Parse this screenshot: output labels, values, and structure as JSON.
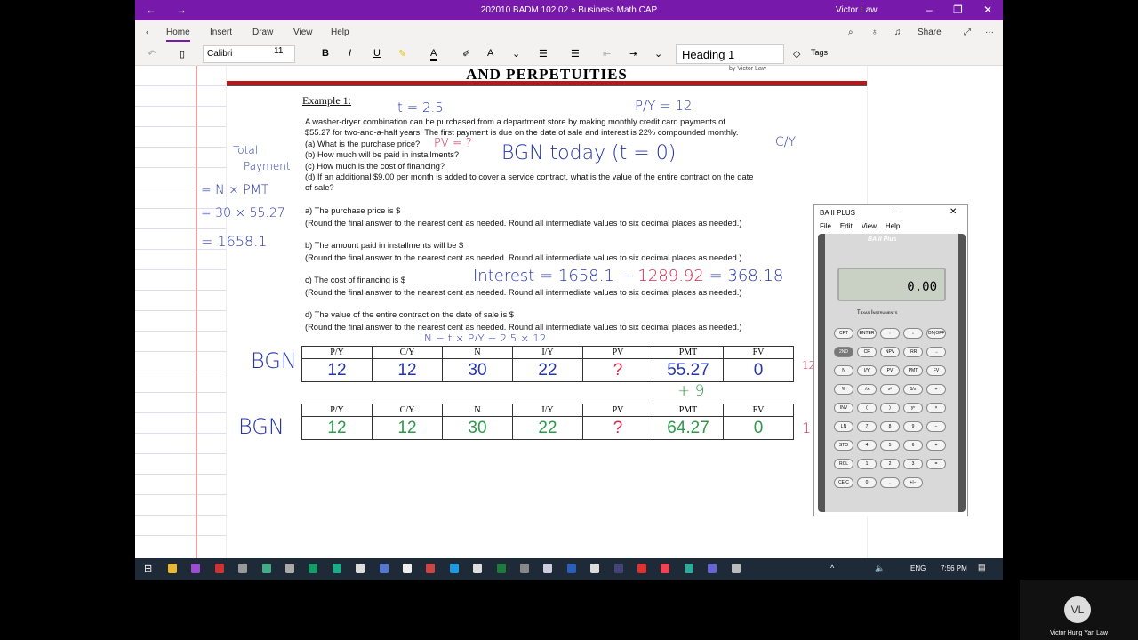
{
  "window": {
    "title": "202010 BADM 102 02 » Business Math CAP",
    "user": "Victor Law",
    "back": "←",
    "forward": "→",
    "min": "–",
    "max": "❐",
    "close": "✕"
  },
  "ribbon": {
    "tabs": [
      "Home",
      "Insert",
      "Draw",
      "View",
      "Help"
    ],
    "share": "Share",
    "more": "···"
  },
  "toolbar": {
    "font": "Calibri",
    "size": "11",
    "bold": "B",
    "italic": "I",
    "underline": "U",
    "font_color": "A",
    "style": "Heading 1",
    "tags": "Tags"
  },
  "doc": {
    "header": "AND PERPETUITIES",
    "byline": "by Victor Law",
    "example": "Example 1:",
    "problem": [
      "A washer-dryer combination can be purchased from a department store by making monthly credit card payments of",
      "$55.27 for two-and-a-half years. The first payment is due on the date of sale and interest is 22% compounded monthly.",
      "(a) What is the purchase price?",
      "(b) How much will be paid in installments?",
      "(c) How much is the cost of financing?",
      "(d) If an additional $9.00 per month is added to cover a service contract, what is the value of the entire contract on the date",
      "of sale?"
    ],
    "answers": [
      "a) The purchase price is $",
      "b) The amount paid in installments will be $",
      "c) The cost of financing is $",
      "d) The value of the entire contract on the date of sale is $"
    ],
    "round_note": "(Round the final answer to the nearest cent as needed. Round all intermediate values to six decimal places as needed.)",
    "table_headers": [
      "P/Y",
      "C/Y",
      "N",
      "I/Y",
      "PV",
      "PMT",
      "FV"
    ],
    "table1": [
      "12",
      "12",
      "30",
      "22",
      "?",
      "55.27",
      "0"
    ],
    "table2": [
      "12",
      "12",
      "30",
      "22",
      "?",
      "64.27",
      "0"
    ]
  },
  "handwriting": {
    "t": "t = 2.5",
    "py": "P/Y = 12",
    "pv": "PV = ?",
    "bgn_today": "BGN today (t = 0)",
    "cy": "C/Y",
    "total": "Total",
    "payment": "Payment",
    "nxpmt": "= N × PMT",
    "calc1": "= 30 × 55.27",
    "calc2": "= 1658.1",
    "interest": "Interest = 1658.1 − ",
    "pv_val": "1289.92",
    "int_result": " = 368.18",
    "nformula": "N = t × P/Y = 2.5 × 12",
    "bgn1": "BGN",
    "bgn2": "BGN",
    "plus9": "+ 9",
    "side1": "12",
    "side2": "1"
  },
  "calculator": {
    "title": "BA II PLUS",
    "menu": [
      "File",
      "Edit",
      "View",
      "Help"
    ],
    "brand": "BA II Plus",
    "maker": "Texas Instruments",
    "display": "0.00",
    "keys": [
      "CPT",
      "ENTER",
      "↑",
      "↓",
      "ON|OFF",
      "2ND",
      "CF",
      "NPV",
      "IRR",
      "→",
      "N",
      "I/Y",
      "PV",
      "PMT",
      "FV",
      "%",
      "√x",
      "x²",
      "1/x",
      "÷",
      "INV",
      "(",
      ")",
      "yˣ",
      "×",
      "LN",
      "7",
      "8",
      "9",
      "−",
      "STO",
      "4",
      "5",
      "6",
      "+",
      "RCL",
      "1",
      "2",
      "3",
      "=",
      "CE|C",
      "0",
      ".",
      "+|−",
      ""
    ]
  },
  "taskbar": {
    "lang": "ENG",
    "time": "7:56 PM"
  },
  "participant": {
    "initials": "VL",
    "name": "Victor Hung Yan Law"
  },
  "colors": {
    "accent": "#7719aa",
    "ink_blue": "#2636a8",
    "ink_red": "#d5264a",
    "ink_green": "#2d9a4a"
  }
}
